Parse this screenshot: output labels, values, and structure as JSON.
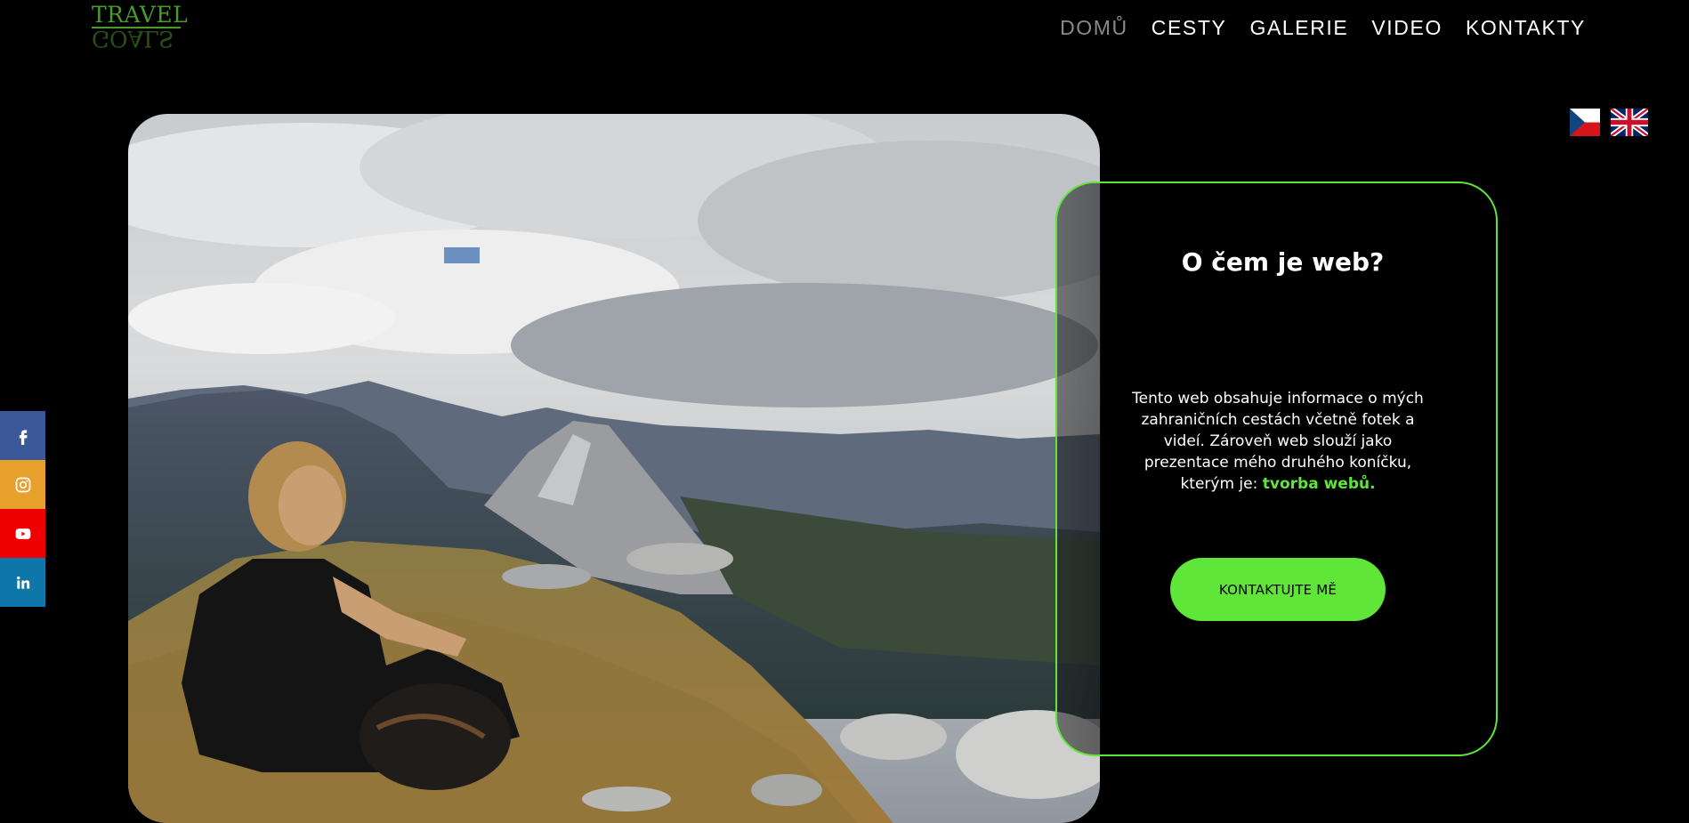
{
  "logo": {
    "text": "TRAVEL",
    "mirror_text": "GOALS"
  },
  "nav": {
    "items": [
      {
        "label": "DOMŮ",
        "active": true
      },
      {
        "label": "CESTY"
      },
      {
        "label": "GALERIE"
      },
      {
        "label": "VIDEO"
      },
      {
        "label": "KONTAKTY"
      }
    ]
  },
  "flags": [
    {
      "icon": "czech-flag-icon"
    },
    {
      "icon": "uk-flag-icon"
    }
  ],
  "card": {
    "title": "O čem je web?",
    "text_before": "Tento web obsahuje informace o mých zahraničních cestách včetně fotek a videí. Zároveň web slouží jako prezentace mého druhého koníčku, kterým je: ",
    "highlight": "tvorba webů.",
    "button": "KONTAKTUJTE MĚ"
  },
  "social": [
    {
      "icon": "facebook-icon",
      "color": "#3b5998"
    },
    {
      "icon": "instagram-icon",
      "color": "#e8a02c"
    },
    {
      "icon": "youtube-icon",
      "color": "#ee0000"
    },
    {
      "icon": "linkedin-icon",
      "color": "#0e76a8"
    }
  ],
  "colors": {
    "accent": "#5fe639",
    "background": "#000000",
    "nav_active": "#8a8a8a"
  }
}
